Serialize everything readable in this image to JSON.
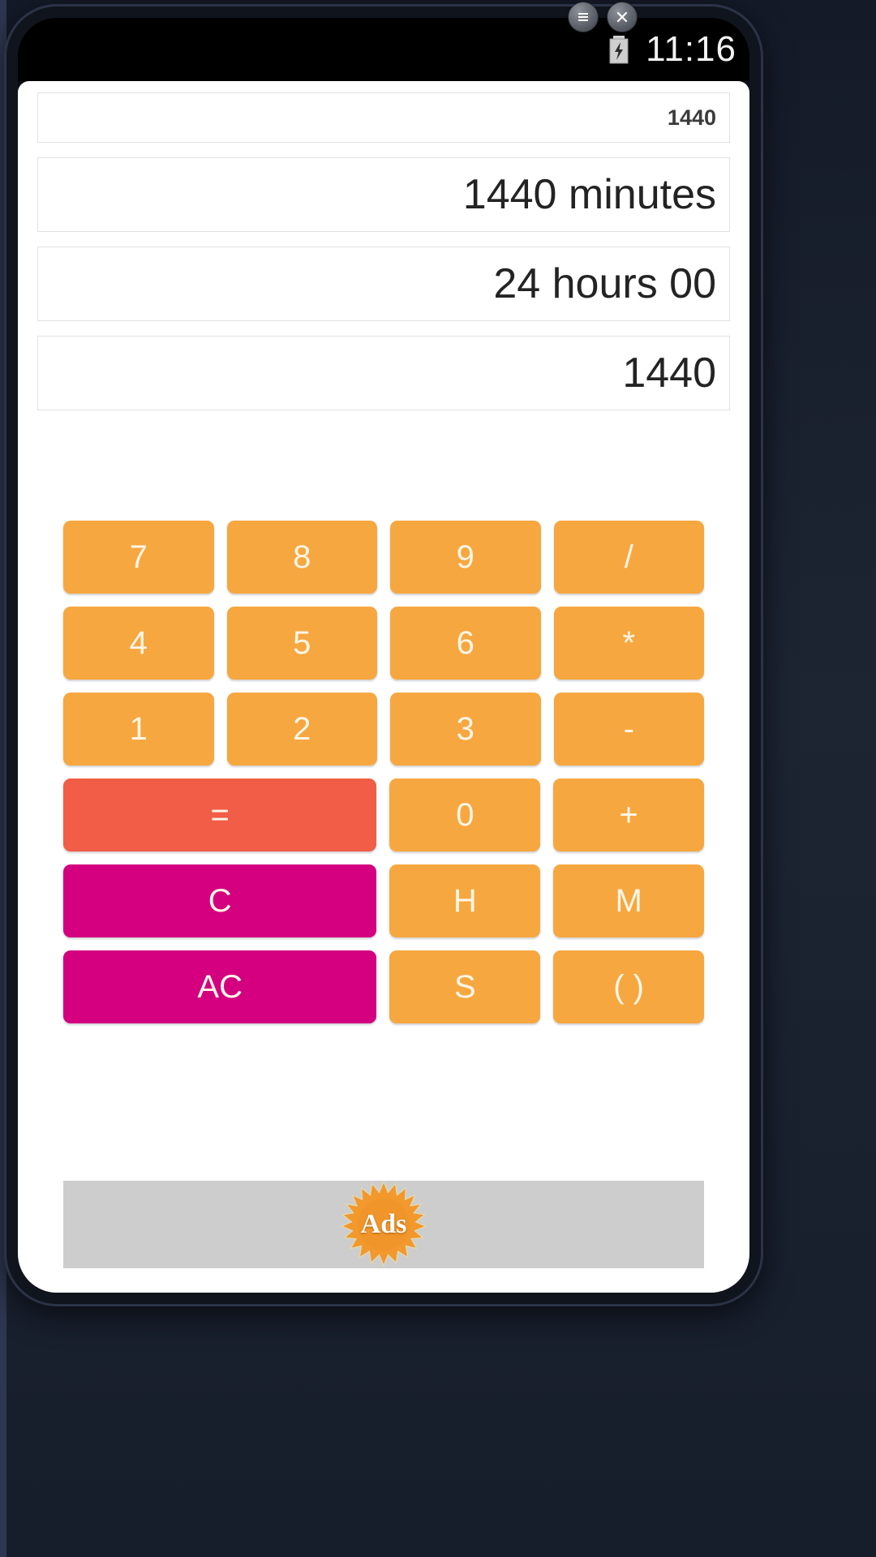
{
  "window_controls": [
    {
      "name": "menu-button",
      "glyph": "menu"
    },
    {
      "name": "close-button",
      "glyph": "close"
    }
  ],
  "status_bar": {
    "clock": "11:16",
    "battery_icon": "battery-charging-icon"
  },
  "displays": [
    {
      "name": "expression-field",
      "value": "1440"
    },
    {
      "name": "minutes-result-field",
      "value": "1440 minutes"
    },
    {
      "name": "hours-result-field",
      "value": "24 hours 00"
    },
    {
      "name": "seconds-result-field",
      "value": "1440"
    }
  ],
  "keypad": {
    "rows": [
      [
        {
          "label": "7",
          "style": "orange",
          "wide": false,
          "name": "key-7"
        },
        {
          "label": "8",
          "style": "orange",
          "wide": false,
          "name": "key-8"
        },
        {
          "label": "9",
          "style": "orange",
          "wide": false,
          "name": "key-9"
        },
        {
          "label": "/",
          "style": "orange",
          "wide": false,
          "name": "key-divide"
        }
      ],
      [
        {
          "label": "4",
          "style": "orange",
          "wide": false,
          "name": "key-4"
        },
        {
          "label": "5",
          "style": "orange",
          "wide": false,
          "name": "key-5"
        },
        {
          "label": "6",
          "style": "orange",
          "wide": false,
          "name": "key-6"
        },
        {
          "label": "*",
          "style": "orange",
          "wide": false,
          "name": "key-multiply"
        }
      ],
      [
        {
          "label": "1",
          "style": "orange",
          "wide": false,
          "name": "key-1"
        },
        {
          "label": "2",
          "style": "orange",
          "wide": false,
          "name": "key-2"
        },
        {
          "label": "3",
          "style": "orange",
          "wide": false,
          "name": "key-3"
        },
        {
          "label": "-",
          "style": "orange",
          "wide": false,
          "name": "key-minus"
        }
      ],
      [
        {
          "label": "=",
          "style": "red",
          "wide": true,
          "name": "key-equals"
        },
        {
          "label": "0",
          "style": "orange",
          "wide": false,
          "name": "key-0"
        },
        {
          "label": "+",
          "style": "orange",
          "wide": false,
          "name": "key-plus"
        }
      ],
      [
        {
          "label": "C",
          "style": "pink",
          "wide": true,
          "name": "key-clear"
        },
        {
          "label": "H",
          "style": "orange",
          "wide": false,
          "name": "key-hours"
        },
        {
          "label": "M",
          "style": "orange",
          "wide": false,
          "name": "key-minutes"
        }
      ],
      [
        {
          "label": "AC",
          "style": "pink",
          "wide": true,
          "name": "key-all-clear"
        },
        {
          "label": "S",
          "style": "orange",
          "wide": false,
          "name": "key-seconds"
        },
        {
          "label": "( )",
          "style": "orange",
          "wide": false,
          "name": "key-parentheses"
        }
      ]
    ]
  },
  "ad": {
    "label": "Ads",
    "badge_color": "#f2982c"
  },
  "colors": {
    "orange": "#f7a740",
    "red": "#f15d46",
    "pink": "#d40080",
    "ad_background": "#cdcdcd"
  }
}
